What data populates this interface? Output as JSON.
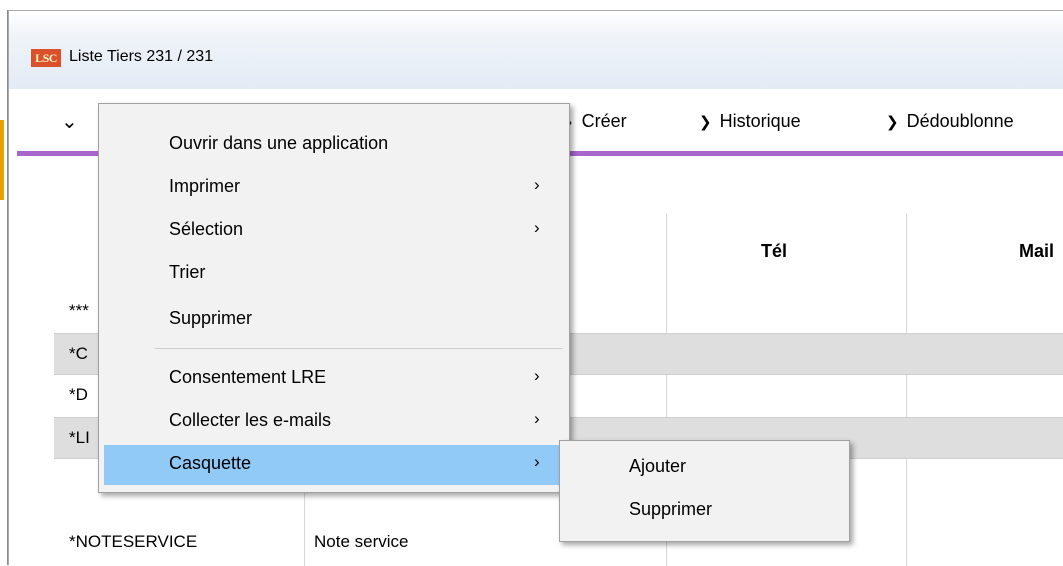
{
  "window": {
    "logo_text": "LSC",
    "title": "Liste  Tiers 231 / 231"
  },
  "toolbar": {
    "items": [
      {
        "label": "Créer"
      },
      {
        "label": "Historique"
      },
      {
        "label": "Dédoublonne"
      }
    ]
  },
  "table": {
    "headers": [
      "Tél",
      "Mail"
    ],
    "rows": [
      {
        "code": "***",
        "name": ""
      },
      {
        "code": "*C",
        "name": ""
      },
      {
        "code": "*D",
        "name": ""
      },
      {
        "code": "*LI",
        "name": ""
      },
      {
        "code": "*NOTESERVICE",
        "name": "Note service"
      }
    ]
  },
  "context_menu": {
    "items": [
      {
        "label": "Ouvrir dans une application",
        "has_submenu": false
      },
      {
        "label": "Imprimer",
        "has_submenu": true
      },
      {
        "label": "Sélection",
        "has_submenu": true
      },
      {
        "label": "Trier",
        "has_submenu": false
      },
      {
        "label": "Supprimer",
        "has_submenu": false
      },
      {
        "label": "Consentement LRE",
        "has_submenu": true
      },
      {
        "label": "Collecter les e-mails",
        "has_submenu": true
      },
      {
        "label": "Casquette",
        "has_submenu": true,
        "highlighted": true
      }
    ],
    "submenu_arrow": "›"
  },
  "submenu": {
    "items": [
      {
        "label": "Ajouter"
      },
      {
        "label": "Supprimer"
      }
    ]
  },
  "colors": {
    "accent_line": "#a865cc",
    "menu_highlight": "#91c9f7",
    "row_gray": "#dedede"
  }
}
